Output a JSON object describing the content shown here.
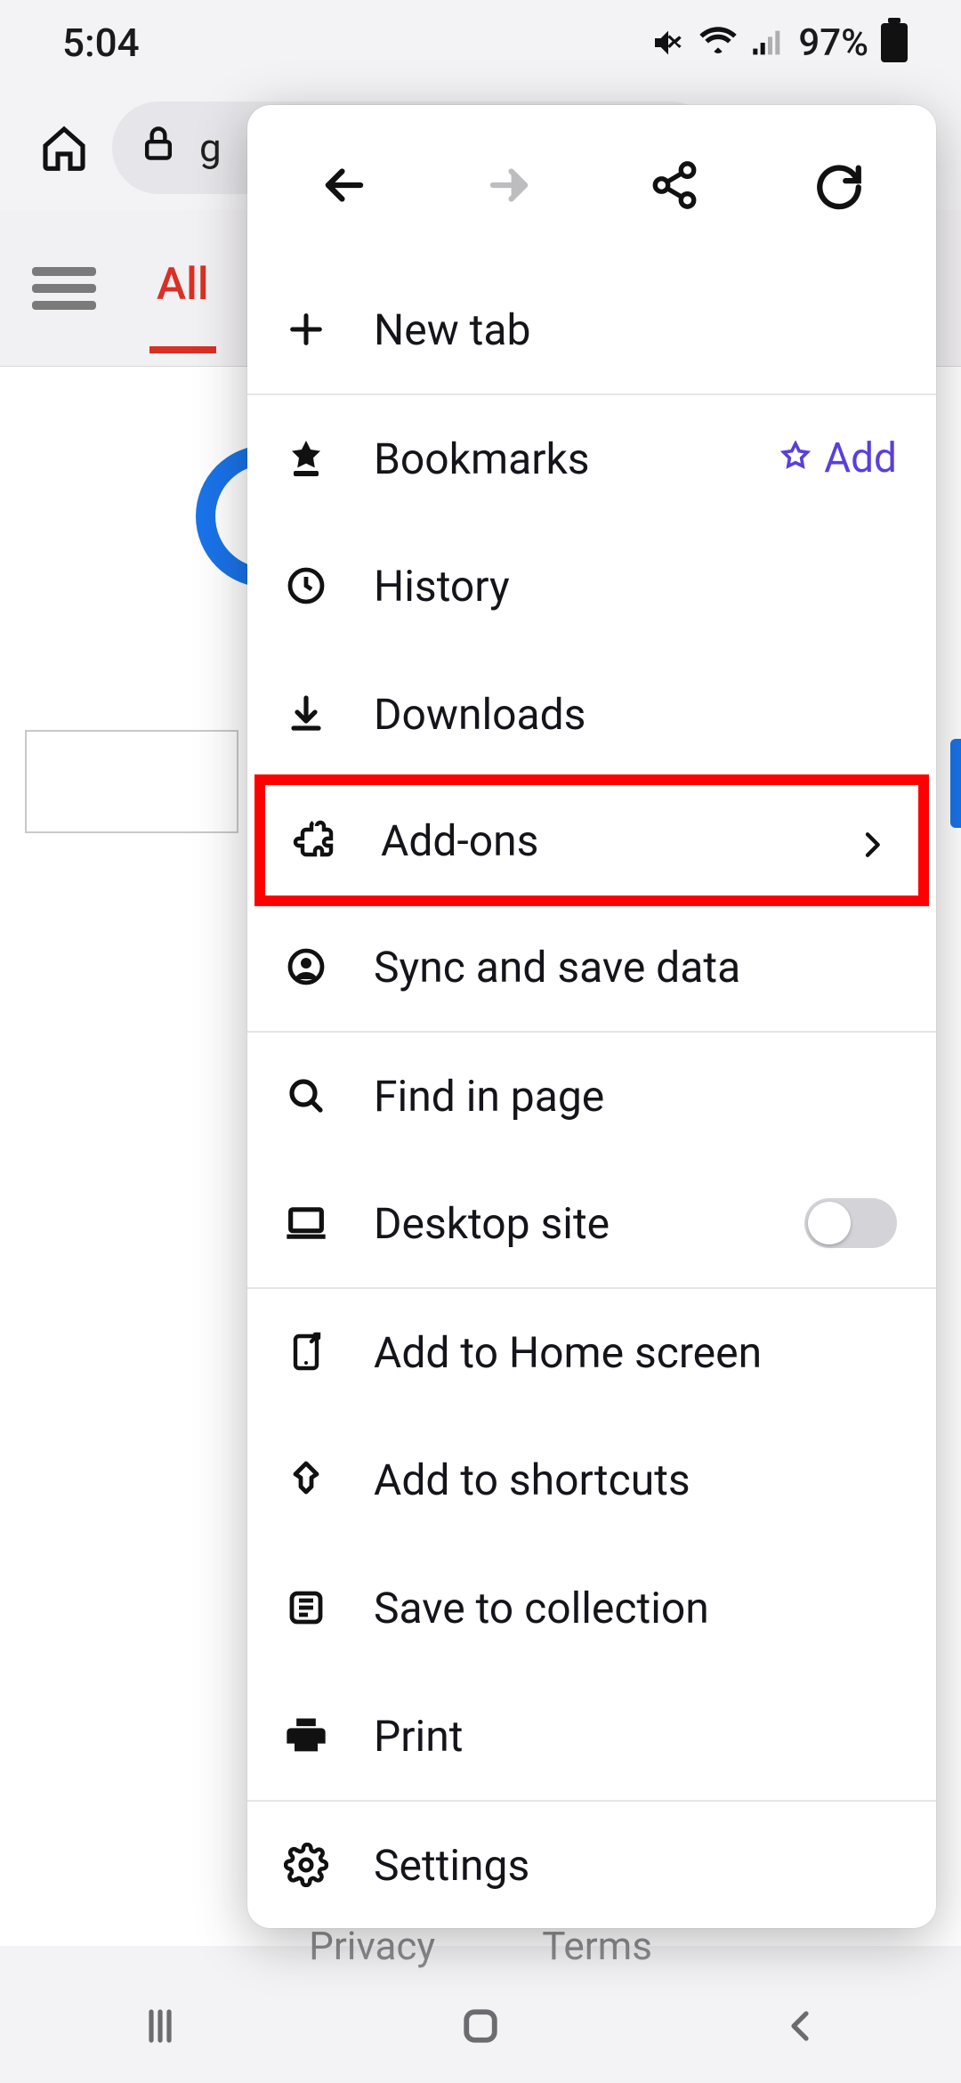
{
  "status": {
    "time": "5:04",
    "battery_pct": "97%"
  },
  "chrome": {
    "url_first_char": "g"
  },
  "page": {
    "tab_all": "All",
    "footer_privacy": "Privacy",
    "footer_terms": "Terms"
  },
  "menu": {
    "new_tab": "New tab",
    "bookmarks": "Bookmarks",
    "bookmarks_add": "Add",
    "history": "History",
    "downloads": "Downloads",
    "addons": "Add-ons",
    "sync": "Sync and save data",
    "find": "Find in page",
    "desktop": "Desktop site",
    "home_screen": "Add to Home screen",
    "shortcuts": "Add to shortcuts",
    "collection": "Save to collection",
    "print": "Print",
    "settings": "Settings"
  }
}
